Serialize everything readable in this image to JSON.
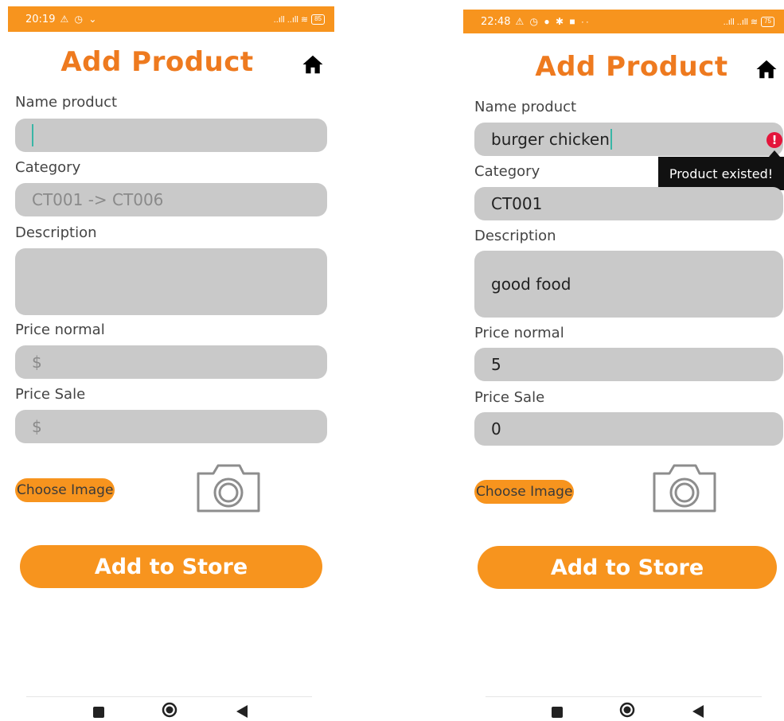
{
  "colors": {
    "accent": "#f7941e",
    "title": "#ee7a1f",
    "field_bg": "#c9c9c9",
    "error": "#e4153b"
  },
  "screens": [
    {
      "status": {
        "time": "20:19",
        "icons": "⚠ ◷ ⌄",
        "signal": "..ıll ..ıll ≋",
        "battery": "85"
      },
      "title": "Add Product",
      "labels": {
        "name": "Name product",
        "category": "Category",
        "description": "Description",
        "price_normal": "Price normal",
        "price_sale": "Price Sale"
      },
      "placeholders": {
        "category": "CT001 -> CT006",
        "price_normal": "$",
        "price_sale": "$"
      },
      "values": {
        "name": "",
        "category": "",
        "description": "",
        "price_normal": "",
        "price_sale": ""
      },
      "choose_image": "Choose Image",
      "add_button": "Add to Store"
    },
    {
      "status": {
        "time": "22:48",
        "icons": "⚠ ◷ ● ✱ ■ ··",
        "signal": "..ıll ..ıll ≋",
        "battery": "75"
      },
      "title": "Add Product",
      "labels": {
        "name": "Name product",
        "category": "Category",
        "description": "Description",
        "price_normal": "Price normal",
        "price_sale": "Price Sale"
      },
      "values": {
        "name": "burger chicken",
        "category": "CT001",
        "description": "good food",
        "price_normal": "5",
        "price_sale": "0"
      },
      "error_tooltip": "Product existed!",
      "choose_image": "Choose Image",
      "add_button": "Add to Store"
    }
  ]
}
